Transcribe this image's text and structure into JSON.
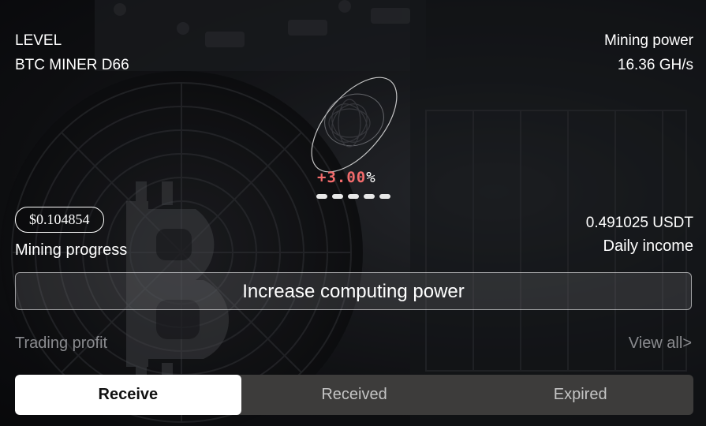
{
  "header": {
    "level_label": "LEVEL",
    "miner_name": "BTC MINER D66",
    "power_label": "Mining power",
    "power_value": "16.36 GH/s"
  },
  "orb": {
    "percent_sign": "+",
    "percent_value": "3.00",
    "percent_unit": "%",
    "page_dots": 5
  },
  "stats": {
    "price": "$0.104854",
    "progress_label": "Mining progress",
    "daily_value": "0.491025 USDT",
    "daily_label": "Daily income"
  },
  "cta": {
    "label": "Increase computing power"
  },
  "trading": {
    "title": "Trading profit",
    "view_all": "View all>"
  },
  "tabs": [
    {
      "label": "Receive",
      "active": true
    },
    {
      "label": "Received",
      "active": false
    },
    {
      "label": "Expired",
      "active": false
    }
  ],
  "colors": {
    "percent": "#f26b6b",
    "muted_text": "#8a8b8f",
    "tab_bar": "#3d3c3b",
    "tab_active": "#ffffff"
  }
}
